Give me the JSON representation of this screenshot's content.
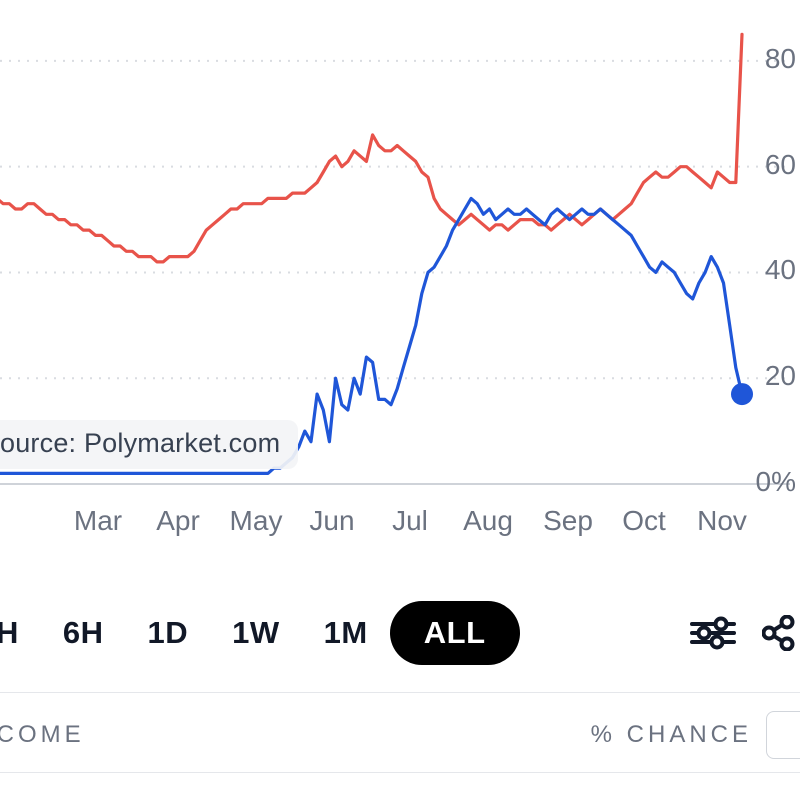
{
  "chart_data": {
    "type": "line",
    "title": "",
    "subtitle": "",
    "source_note": "ource: Polymarket.com",
    "xlabel": "",
    "ylabel": "",
    "ylim": [
      0,
      90
    ],
    "yticks": [
      "0%",
      "20",
      "40",
      "60",
      "80"
    ],
    "ytick_values": [
      0,
      20,
      40,
      60,
      80
    ],
    "xticks": [
      "Mar",
      "Apr",
      "May",
      "Jun",
      "Jul",
      "Aug",
      "Sep",
      "Oct",
      "Nov"
    ],
    "grid": true,
    "legend_position": "none",
    "series": [
      {
        "name": "Red outcome",
        "color": "#e8534a",
        "end_value": 57,
        "values": [
          52,
          53,
          53,
          54,
          53,
          53,
          54,
          53,
          53,
          52,
          52,
          53,
          53,
          52,
          51,
          51,
          50,
          50,
          49,
          49,
          48,
          48,
          47,
          47,
          46,
          45,
          45,
          44,
          44,
          43,
          43,
          43,
          42,
          42,
          43,
          43,
          43,
          43,
          44,
          46,
          48,
          49,
          50,
          51,
          52,
          52,
          53,
          53,
          53,
          53,
          54,
          54,
          54,
          54,
          55,
          55,
          55,
          56,
          57,
          59,
          61,
          62,
          60,
          61,
          63,
          62,
          61,
          66,
          64,
          63,
          63,
          64,
          63,
          62,
          61,
          59,
          58,
          54,
          52,
          51,
          50,
          49,
          50,
          51,
          50,
          49,
          48,
          49,
          49,
          48,
          49,
          50,
          50,
          50,
          49,
          49,
          48,
          49,
          50,
          51,
          50,
          49,
          50,
          51,
          52,
          51,
          50,
          51,
          52,
          53,
          55,
          57,
          58,
          59,
          58,
          58,
          59,
          60,
          60,
          59,
          58,
          57,
          56,
          59,
          58,
          57,
          57,
          85
        ]
      },
      {
        "name": "Blue outcome",
        "color": "#1f56d8",
        "end_value": 17,
        "values": [
          2,
          2,
          2,
          2,
          2,
          2,
          2,
          2,
          2,
          2,
          2,
          2,
          2,
          2,
          2,
          2,
          2,
          2,
          2,
          2,
          2,
          2,
          2,
          2,
          2,
          2,
          2,
          2,
          2,
          2,
          2,
          2,
          2,
          2,
          2,
          2,
          2,
          2,
          2,
          2,
          2,
          2,
          2,
          2,
          2,
          2,
          2,
          2,
          2,
          2,
          2,
          3,
          3,
          4,
          5,
          7,
          10,
          8,
          17,
          14,
          8,
          20,
          15,
          14,
          20,
          17,
          24,
          23,
          16,
          16,
          15,
          18,
          22,
          26,
          30,
          36,
          40,
          41,
          43,
          45,
          48,
          50,
          52,
          54,
          53,
          51,
          52,
          50,
          51,
          52,
          51,
          51,
          52,
          51,
          50,
          49,
          51,
          52,
          51,
          50,
          51,
          52,
          51,
          51,
          52,
          51,
          50,
          49,
          48,
          47,
          45,
          43,
          41,
          40,
          42,
          41,
          40,
          38,
          36,
          35,
          38,
          40,
          43,
          41,
          38,
          30,
          22,
          17
        ]
      }
    ]
  },
  "source": {
    "label": "ource: Polymarket.com"
  },
  "range_selector": {
    "options": [
      {
        "label": "H",
        "active": false
      },
      {
        "label": "6H",
        "active": false
      },
      {
        "label": "1D",
        "active": false
      },
      {
        "label": "1W",
        "active": false
      },
      {
        "label": "1M",
        "active": false
      },
      {
        "label": "ALL",
        "active": true
      }
    ],
    "tools": [
      {
        "name": "settings-sliders-icon"
      },
      {
        "name": "share-icon"
      }
    ]
  },
  "table": {
    "columns": {
      "outcome": "TCOME",
      "chance": "% CHANCE"
    }
  },
  "colors": {
    "red_series": "#e8534a",
    "blue_series": "#1f56d8",
    "active_pill": "#000000",
    "axis_text": "#6b7280",
    "grid": "#d9dce1"
  }
}
